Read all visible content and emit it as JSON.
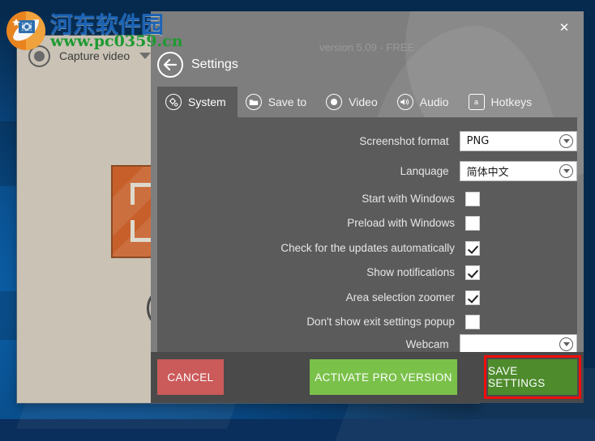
{
  "watermark": {
    "site_name_cn": "河东软件园",
    "site_url": "www.pc0359.cn",
    "logo_icon": "watermark-logo-icon"
  },
  "app_window": {
    "capture_video_label": "Capture video",
    "capture_video_icon": "record-dot-icon",
    "capture_video_caret_icon": "chevron-down-icon",
    "big_icon_name": "screen-capture-icon",
    "round_button_icon": "record-circle-icon"
  },
  "dialog": {
    "version_text": "version 5.09 - FREE",
    "close_icon": "close-icon",
    "close_glyph": "✕",
    "back_icon": "back-arrow-icon",
    "title": "Settings",
    "accent_red": "#f20d0d",
    "cancel_color": "#cb5a5a",
    "activate_color": "#7ac14a",
    "save_color": "#4d8b2c"
  },
  "tabs": [
    {
      "label": "System",
      "icon": "gears-icon",
      "active": true
    },
    {
      "label": "Save to",
      "icon": "folder-icon",
      "active": false
    },
    {
      "label": "Video",
      "icon": "record-icon",
      "active": false
    },
    {
      "label": "Audio",
      "icon": "speaker-icon",
      "active": false
    },
    {
      "label": "Hotkeys",
      "icon": "keyboard-a-icon",
      "active": false
    }
  ],
  "settings_rows": [
    {
      "label": "Screenshot format",
      "type": "combo",
      "value": "PNG"
    },
    {
      "label": "Lanquage",
      "type": "combo",
      "value": "简体中文"
    },
    {
      "label": "Start with Windows",
      "type": "checkbox",
      "checked": false
    },
    {
      "label": "Preload with Windows",
      "type": "checkbox",
      "checked": false
    },
    {
      "label": "Check for the updates automatically",
      "type": "checkbox",
      "checked": true
    },
    {
      "label": "Show notifications",
      "type": "checkbox",
      "checked": true
    },
    {
      "label": "Area selection zoomer",
      "type": "checkbox",
      "checked": true
    },
    {
      "label": "Don't show exit settings popup",
      "type": "checkbox",
      "checked": false
    },
    {
      "label": "Webcam",
      "type": "combo",
      "value": ""
    }
  ],
  "footer": {
    "cancel_label": "CANCEL",
    "activate_label": "ACTIVATE PRO VERSION",
    "save_label": "SAVE SETTINGS"
  }
}
